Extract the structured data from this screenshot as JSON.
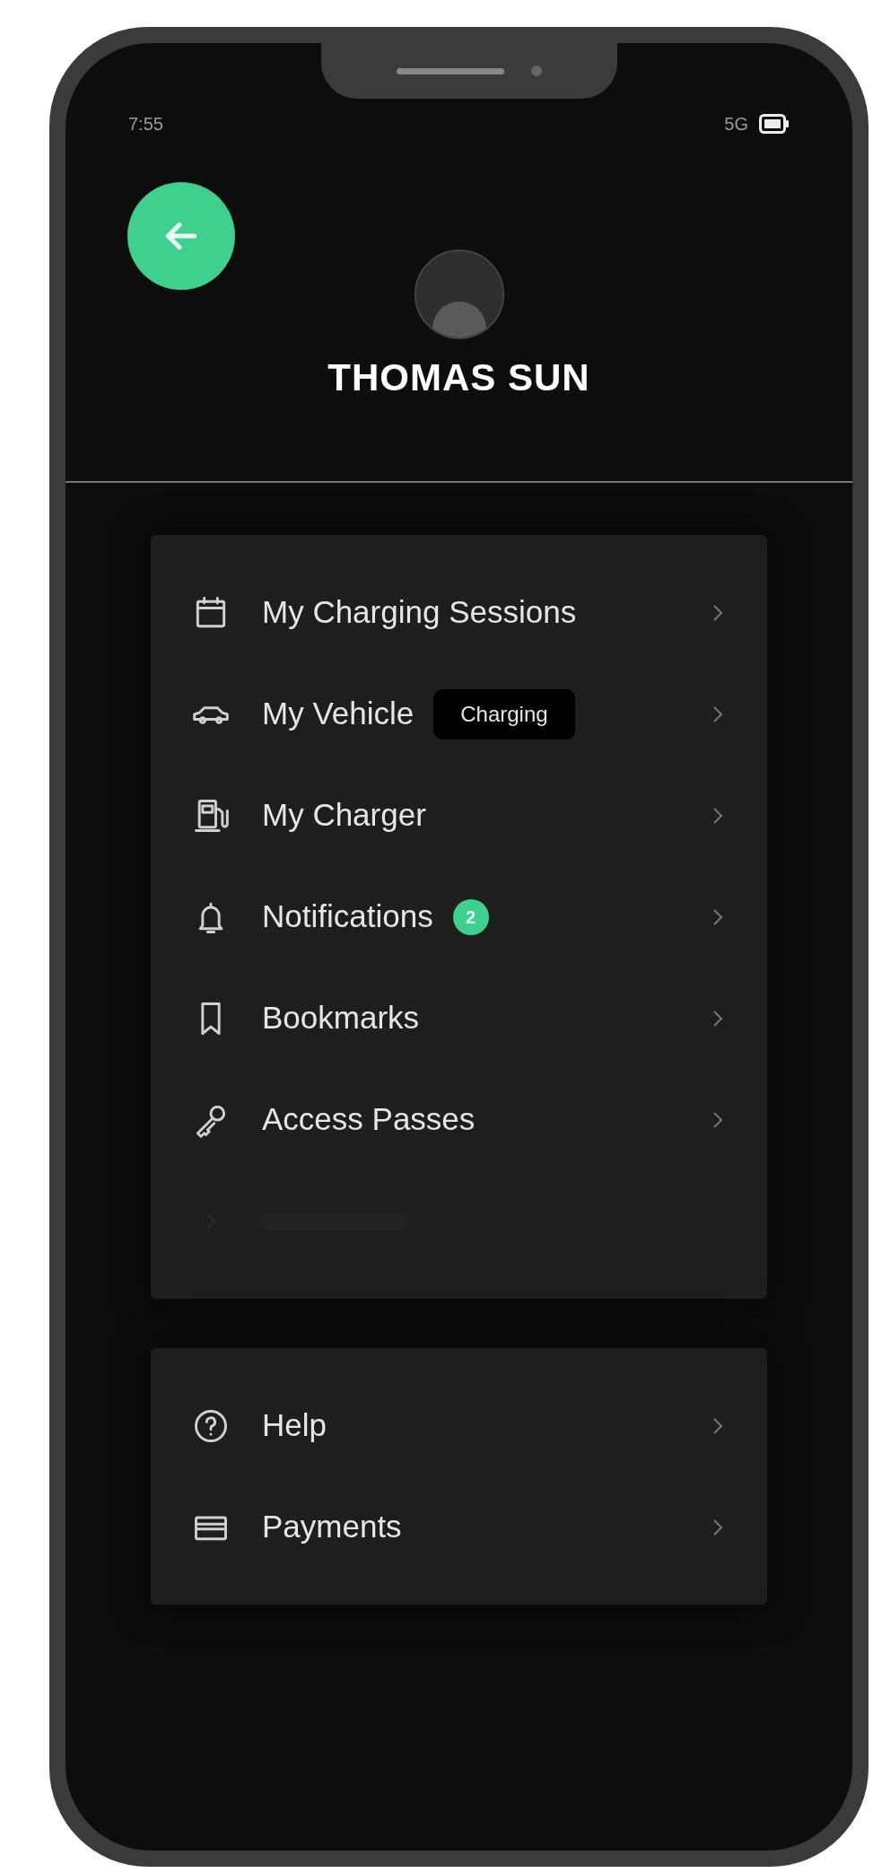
{
  "status_bar": {
    "time": "7:55",
    "network": "5G"
  },
  "profile": {
    "name": "THOMAS SUN"
  },
  "menu_groups": [
    {
      "items": [
        {
          "label": "My Charging Sessions",
          "disabled": false
        },
        {
          "label": "My Vehicle",
          "status": "Charging",
          "disabled": false
        },
        {
          "label": "My Charger",
          "disabled": false
        },
        {
          "label": "Notifications",
          "badge": "2",
          "disabled": false
        },
        {
          "label": "Bookmarks",
          "disabled": false
        },
        {
          "label": "Access Passes",
          "disabled": false
        },
        {
          "disabled": true
        }
      ]
    },
    {
      "items": [
        {
          "label": "Help",
          "disabled": false
        },
        {
          "label": "Payments",
          "disabled": false
        }
      ]
    }
  ]
}
